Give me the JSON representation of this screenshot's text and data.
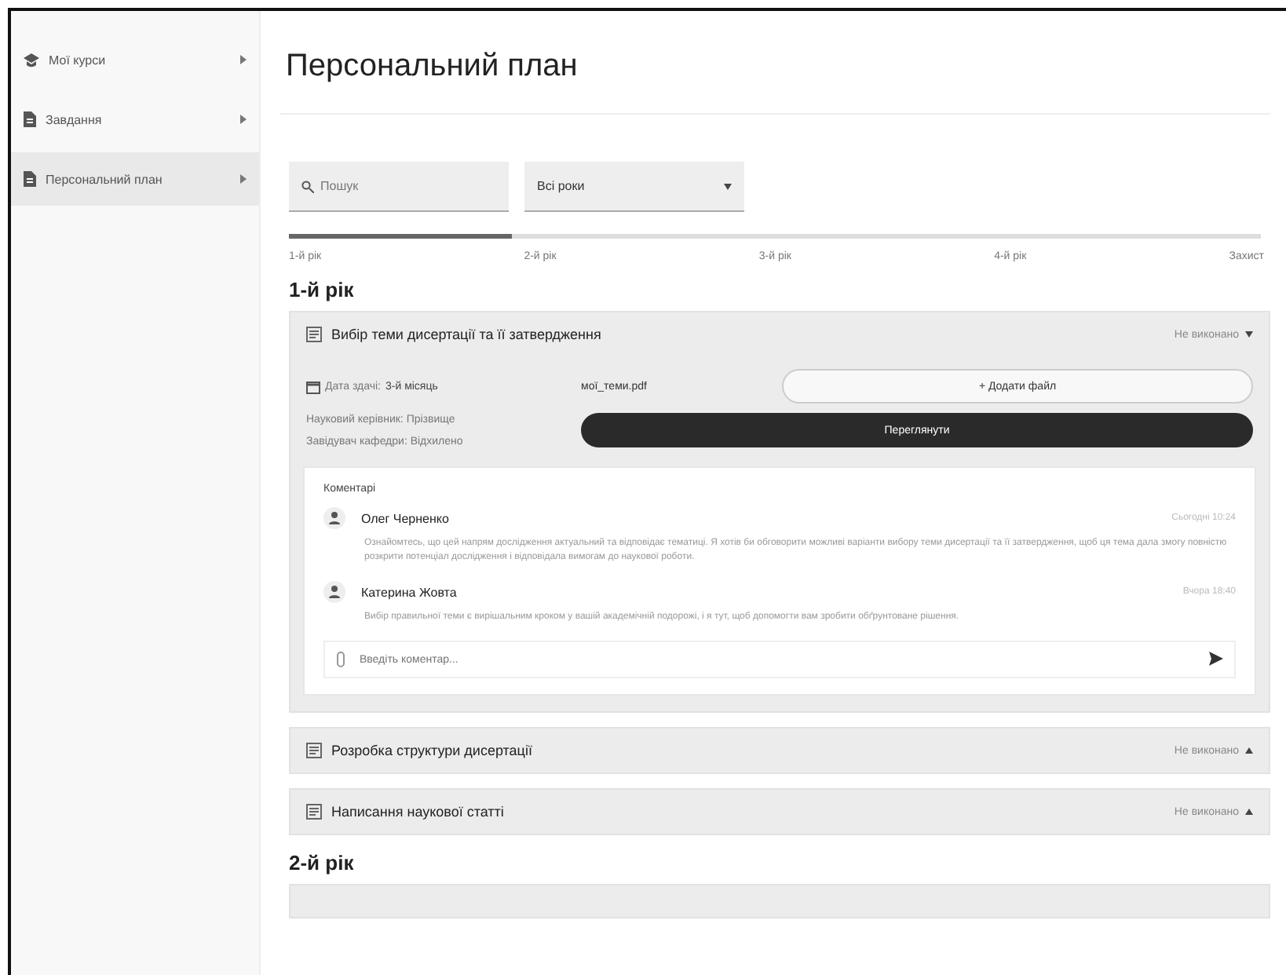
{
  "sidebar": {
    "items": [
      {
        "label": "Мої курси",
        "selected": false
      },
      {
        "label": "Завдання",
        "selected": false
      },
      {
        "label": "Персональний план",
        "selected": true
      }
    ]
  },
  "page_title": "Персональний план",
  "filters": {
    "search": {
      "placeholder": "Пошук"
    },
    "year_select": {
      "value": "Всі роки"
    }
  },
  "timeline": {
    "level": 0.23,
    "steps": [
      "1-й рік",
      "2-й рік",
      "3-й рік",
      "4-й рік",
      "Захист"
    ]
  },
  "years": [
    {
      "title": "1-й рік",
      "tasks": [
        {
          "title": "Вибір теми дисертації та її затвердження",
          "status": "Не виконано",
          "expanded": true,
          "details": {
            "deadline_label": "Дата здачі:",
            "deadline": "3-й місяць",
            "supervisor": "Науковий керівник: Прізвище",
            "head": "Завідувач кафедри: Відхилено",
            "file": "мої_теми.pdf",
            "add_file": "+ Додати файл",
            "action": "Переглянути"
          },
          "comments": {
            "title": "Коментарі",
            "items": [
              {
                "author": "Олег Черненко",
                "time": "Сьогодні 10:24",
                "text": "Ознайомтесь, що цей напрям дослідження актуальний та відповідає тематиці. Я хотів би обговорити можливі варіанти вибору теми дисертації та її затвердження, щоб ця тема дала змогу повністю розкрити потенціал дослідження і відповідала вимогам до наукової роботи."
              },
              {
                "author": "Катерина Жовта",
                "time": "Вчора 18:40",
                "text": "Вибір правильної теми є вирішальним кроком у вашій академічній подорожі, і я тут, щоб допомогти вам зробити обґрунтоване рішення."
              }
            ],
            "input_placeholder": "Введіть коментар..."
          }
        },
        {
          "title": "Розробка структури дисертації",
          "status": "Не виконано",
          "expanded": false
        },
        {
          "title": "Написання наукової статті",
          "status": "Не виконано",
          "expanded": false
        }
      ]
    },
    {
      "title": "2-й рік"
    }
  ]
}
